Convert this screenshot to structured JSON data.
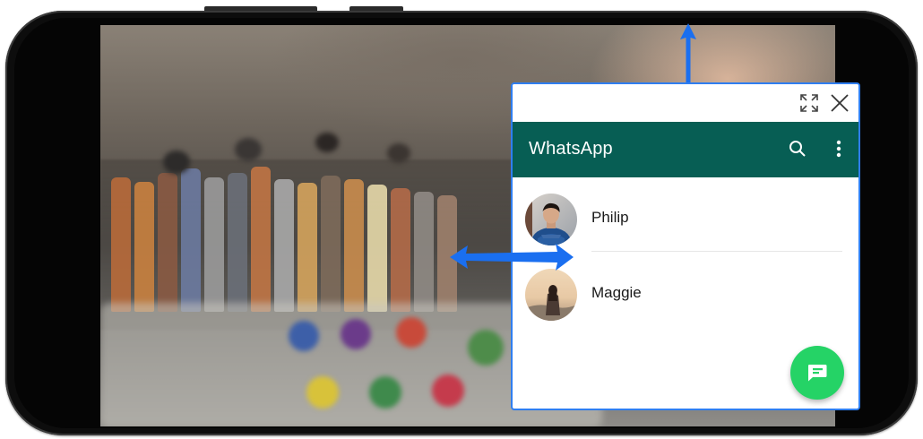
{
  "popup": {
    "expand_icon": "expand-icon",
    "close_icon": "close-icon"
  },
  "app": {
    "title": "WhatsApp",
    "header_color": "#075e54",
    "search_icon": "search-icon",
    "menu_icon": "more-vertical-icon"
  },
  "chats": [
    {
      "name": "Philip",
      "avatar": "avatar-man-blue-shirt"
    },
    {
      "name": "Maggie",
      "avatar": "avatar-woman-sunset"
    }
  ],
  "fab": {
    "icon": "new-chat-icon",
    "color": "#25d366"
  },
  "annotations": {
    "arrow_color": "#1a6ff0"
  }
}
